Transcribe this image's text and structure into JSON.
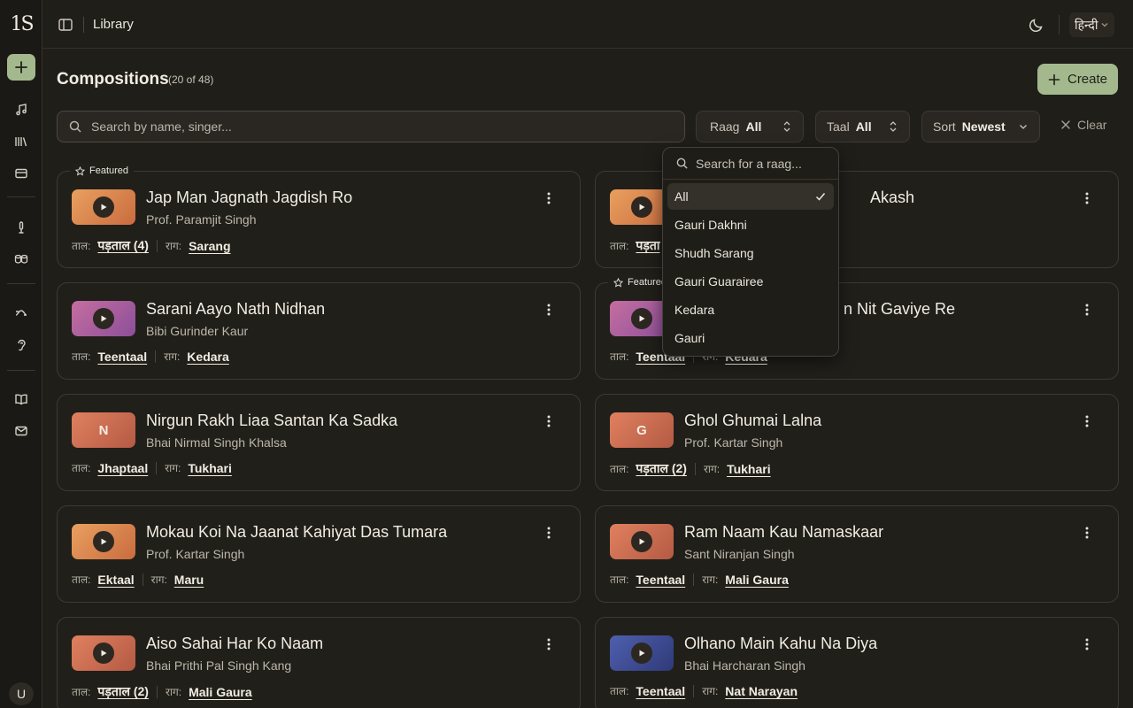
{
  "sidebar": {
    "logo_text": "1S",
    "avatar_initial": "U"
  },
  "topbar": {
    "title": "Library",
    "language": "हिन्दी"
  },
  "header": {
    "title": "Compositions",
    "count": "(20 of 48)",
    "create_label": "Create"
  },
  "search": {
    "placeholder": "Search by name, singer..."
  },
  "filters": {
    "raag": {
      "label": "Raag",
      "value": "All"
    },
    "taal": {
      "label": "Taal",
      "value": "All"
    },
    "sort": {
      "label": "Sort",
      "value": "Newest"
    },
    "clear_label": "Clear"
  },
  "raag_dropdown": {
    "placeholder": "Search for a raag...",
    "options": [
      "All",
      "Gauri Dakhni",
      "Shudh Sarang",
      "Gauri Guarairee",
      "Kedara",
      "Gauri"
    ],
    "selected": "All"
  },
  "labels": {
    "taal": "ताल:",
    "raag": "राग:",
    "featured": "Featured"
  },
  "cards": [
    {
      "title": "Jap Man Jagnath Jagdish Ro",
      "singer": "Prof. Paramjit Singh",
      "taal": "पड़ताल (4)",
      "raag": "Sarang",
      "featured": true,
      "thumb": "play"
    },
    {
      "title": "Akash",
      "singer": "",
      "taal": "पड़ता",
      "raag": "",
      "featured": false,
      "thumb": "play"
    },
    {
      "title": "Sarani Aayo Nath Nidhan",
      "singer": "Bibi Gurinder Kaur",
      "taal": "Teentaal",
      "raag": "Kedara",
      "featured": false,
      "thumb": "play"
    },
    {
      "title": "n Nit Gaviye Re",
      "singer": "",
      "taal": "Teentaal",
      "raag": "Kedara",
      "featured": true,
      "thumb": "play"
    },
    {
      "title": "Nirgun Rakh Liaa Santan Ka Sadka",
      "singer": "Bhai Nirmal Singh Khalsa",
      "taal": "Jhaptaal",
      "raag": "Tukhari",
      "featured": false,
      "thumb": "N"
    },
    {
      "title": "Ghol Ghumai Lalna",
      "singer": "Prof. Kartar Singh",
      "taal": "पड़ताल (2)",
      "raag": "Tukhari",
      "featured": false,
      "thumb": "G"
    },
    {
      "title": "Mokau Koi Na Jaanat Kahiyat Das Tumara",
      "singer": "Prof. Kartar Singh",
      "taal": "Ektaal",
      "raag": "Maru",
      "featured": false,
      "thumb": "play"
    },
    {
      "title": "Ram Naam Kau Namaskaar",
      "singer": "Sant Niranjan Singh",
      "taal": "Teentaal",
      "raag": "Mali Gaura",
      "featured": false,
      "thumb": "play"
    },
    {
      "title": "Aiso Sahai Har Ko Naam",
      "singer": "Bhai Prithi Pal Singh Kang",
      "taal": "पड़ताल (2)",
      "raag": "Mali Gaura",
      "featured": false,
      "thumb": "play"
    },
    {
      "title": "Olhano Main Kahu Na Diya",
      "singer": "Bhai Harcharan Singh",
      "taal": "Teentaal",
      "raag": "Nat Narayan",
      "featured": false,
      "thumb": "play"
    }
  ],
  "colors": {
    "accent": "#a4b88e",
    "background": "#201e19",
    "thumb_orange": "#e0905a",
    "thumb_purple": "#9a5fa0",
    "thumb_coral": "#d67a5a",
    "thumb_blue": "#3c4a8c"
  }
}
